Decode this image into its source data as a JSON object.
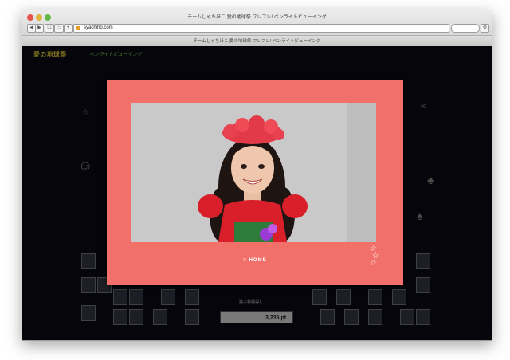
{
  "window": {
    "title": "チームしゃちほこ 愛の地球祭 フレフレ! ペンライトビューイング",
    "url": "syachiho.com",
    "tab_title": "チームしゃちほこ 愛の地球祭 フレフレ! ペンライトビューイング"
  },
  "site": {
    "logo_text": "愛の地球祭",
    "logo_sub": "ペンライトビューイング"
  },
  "score": {
    "label": "独占枠獲得し",
    "value": "3,235 pt."
  },
  "modal": {
    "home_label": "> HOME"
  },
  "colors": {
    "modal_bg": "#f2706a",
    "page_bg": "#0a0a14",
    "accent_yellow": "#e8d13a"
  }
}
